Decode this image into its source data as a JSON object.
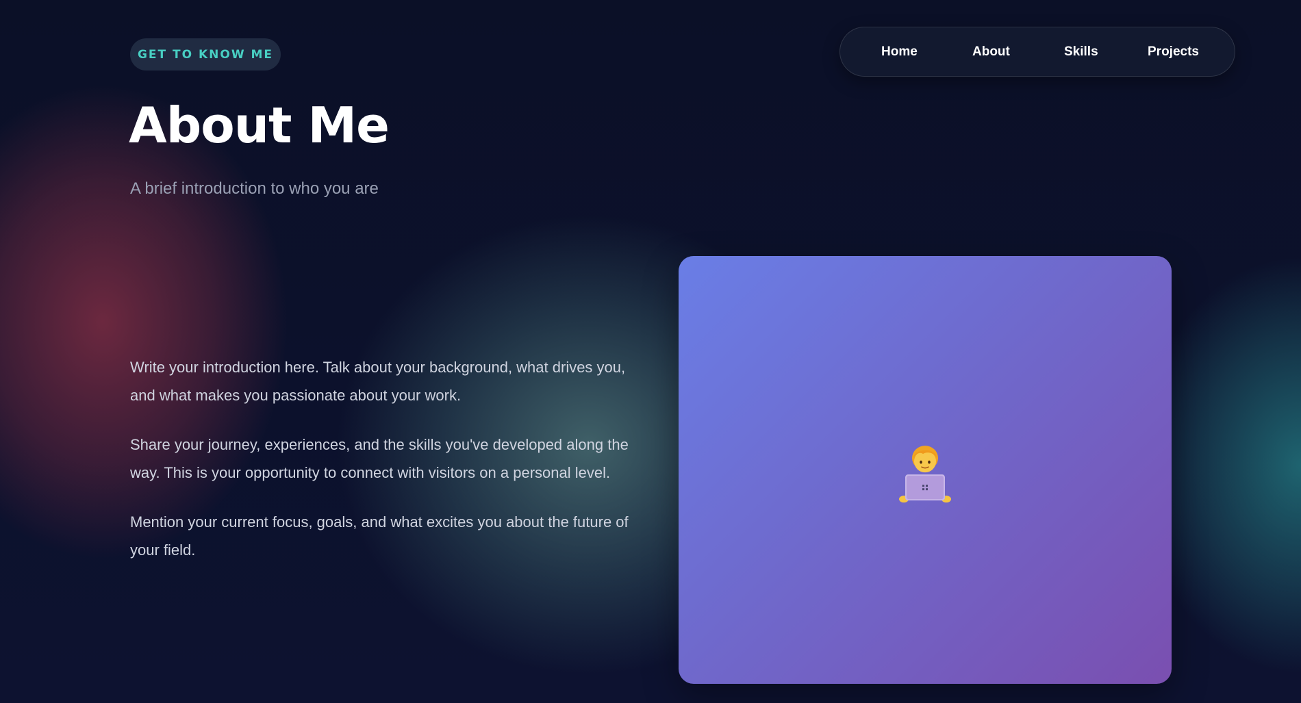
{
  "tag": {
    "label": "GET TO KNOW ME"
  },
  "header": {
    "title": "About Me",
    "subtitle": "A brief introduction to who you are"
  },
  "nav": {
    "items": [
      {
        "label": "Home"
      },
      {
        "label": "About"
      },
      {
        "label": "Skills"
      },
      {
        "label": "Projects"
      }
    ]
  },
  "intro": {
    "paragraphs": [
      "Write your introduction here. Talk about your background, what drives you, and what makes you passionate about your work.",
      "Share your journey, experiences, and the skills you've developed along the way. This is your opportunity to connect with visitors on a personal level.",
      "Mention your current focus, goals, and what excites you about the future of your field."
    ]
  },
  "image_card": {
    "icon": "technologist-emoji-icon"
  },
  "colors": {
    "background": "#0c1128",
    "accent": "#48cfc3",
    "card_gradient_start": "#6a7ee6",
    "card_gradient_end": "#7a4fb0"
  }
}
